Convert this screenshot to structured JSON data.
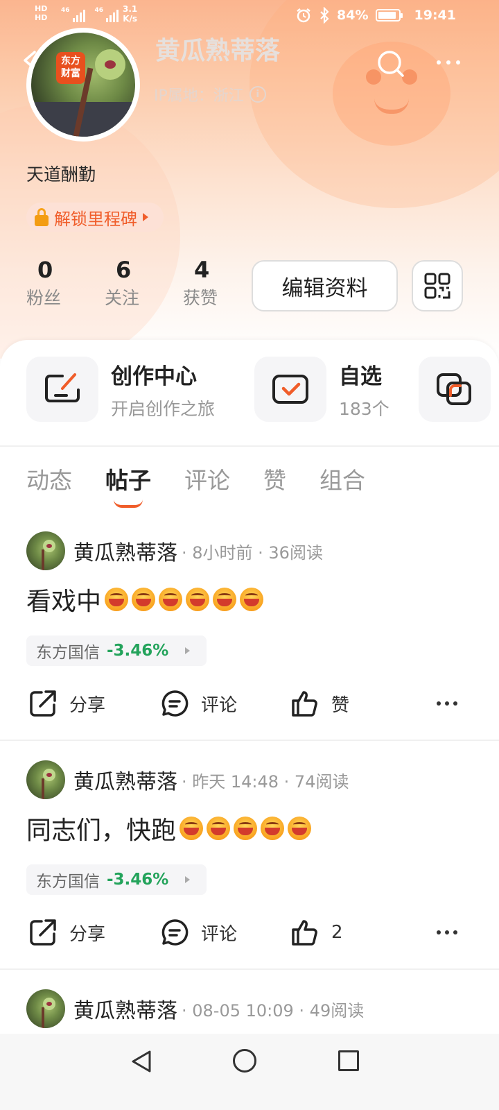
{
  "status_bar": {
    "left_top": "HD",
    "left_bottom": "HD",
    "net1": "46",
    "net2": "46",
    "speed_value": "3.1",
    "speed_unit": "K/s",
    "battery": "84%",
    "time": "19:41"
  },
  "profile": {
    "username": "黄瓜熟蒂落",
    "ip_location": "IP属地：浙江",
    "avatar_logo": "东方财富",
    "bio": "天道酬勤",
    "milestone_label": "解锁里程碑",
    "stats": [
      {
        "value": "0",
        "label": "粉丝"
      },
      {
        "value": "6",
        "label": "关注"
      },
      {
        "value": "4",
        "label": "获赞"
      }
    ],
    "edit_button": "编辑资料"
  },
  "shortcuts": [
    {
      "title": "创作中心",
      "subtitle": "开启创作之旅",
      "icon": "create-icon"
    },
    {
      "title": "自选",
      "subtitle": "183个",
      "icon": "watchlist-icon"
    },
    {
      "icon": "portfolio-icon"
    }
  ],
  "tabs": [
    "动态",
    "帖子",
    "评论",
    "赞",
    "组合"
  ],
  "active_tab": "帖子",
  "posts": [
    {
      "author": "黄瓜熟蒂落",
      "meta": "· 8小时前 · 36阅读",
      "text": "看戏中",
      "emoji_count": 6,
      "stock_name": "东方国信",
      "stock_change": "-3.46%",
      "share": "分享",
      "comment": "评论",
      "like": "赞"
    },
    {
      "author": "黄瓜熟蒂落",
      "meta": "· 昨天 14:48 · 74阅读",
      "text": "同志们，快跑",
      "emoji_count": 5,
      "stock_name": "东方国信",
      "stock_change": "-3.46%",
      "share": "分享",
      "comment": "评论",
      "like": "2"
    },
    {
      "author": "黄瓜熟蒂落",
      "meta": "· 08-05 10:09 · 49阅读"
    }
  ],
  "colors": {
    "accent": "#f05d2a",
    "stock_change": "#23a35b"
  }
}
